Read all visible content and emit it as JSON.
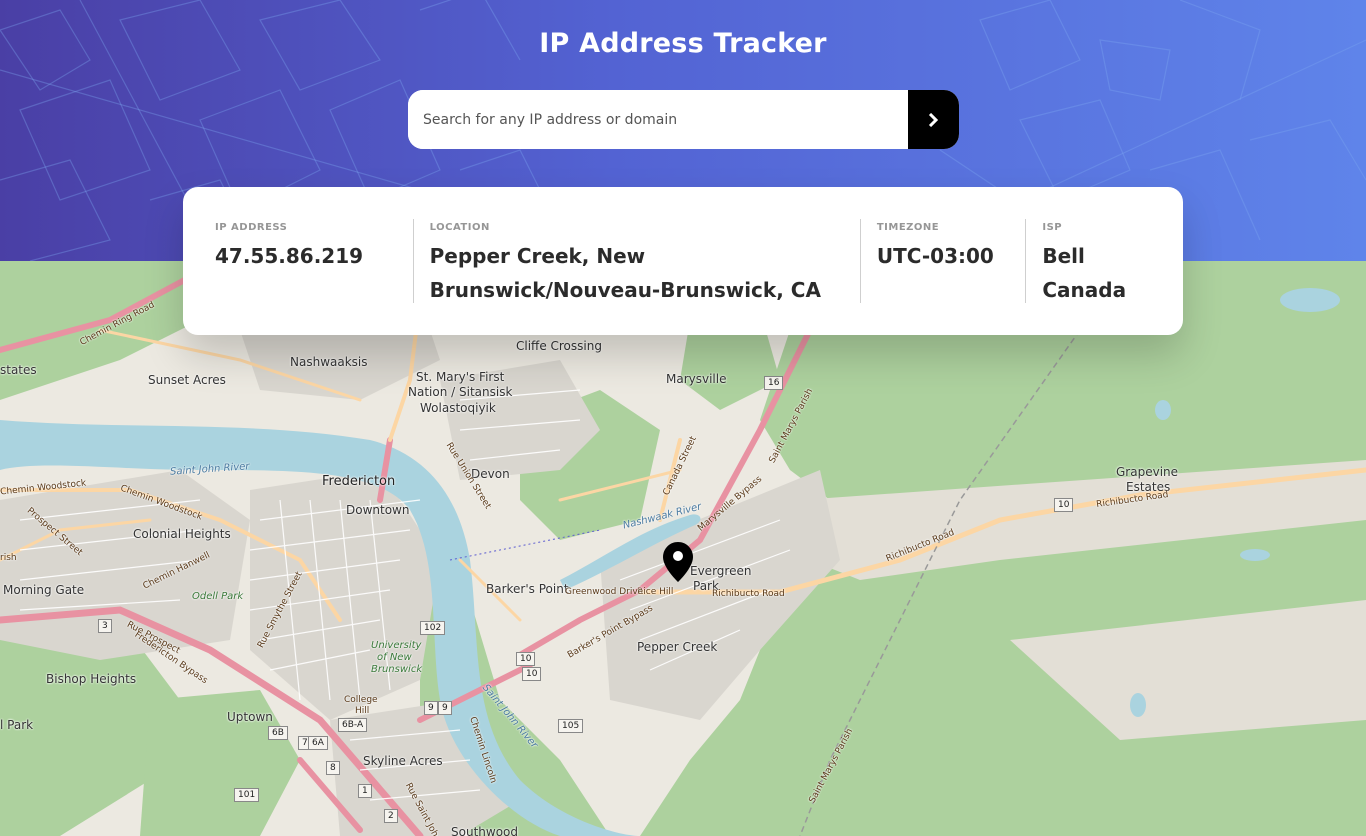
{
  "header": {
    "title": "IP Address Tracker",
    "search_placeholder": "Search for any IP address or domain",
    "search_value": "",
    "submit_icon": "chevron-right-icon"
  },
  "info": {
    "ip_label": "IP ADDRESS",
    "ip_value": "47.55.86.219",
    "location_label": "LOCATION",
    "location_value": "Pepper Creek, New Brunswick/Nouveau-Brunswick, CA",
    "timezone_label": "TIMEZONE",
    "timezone_value": "UTC-03:00",
    "isp_label": "ISP",
    "isp_value": "Bell Canada"
  },
  "map": {
    "marker_icon": "map-pin-icon",
    "places": [
      "Nashwaaksis",
      "Cliffe Crossing",
      "Sunset Acres",
      "St. Mary's First",
      "Nation / Sitansisk",
      "Wolastoqiyik",
      "Marysville",
      "Devon",
      "Fredericton",
      "Downtown",
      "Colonial Heights",
      "Morning Gate",
      "Odell Park",
      "Barker's Point",
      "Evergreen",
      "Park",
      "Rice Hill",
      "Pepper Creek",
      "Bishop Heights",
      "Uptown",
      "University",
      "of New",
      "Brunswick",
      "College",
      "Hill",
      "Skyline Acres",
      "Southwood",
      "Grapevine",
      "Estates",
      "l Park",
      "rish",
      "states"
    ],
    "waters": [
      "Saint John River",
      "Nashwaak River",
      "Saint John River"
    ],
    "roads": [
      "Chemin Ring Road",
      "Chemin Woodstock",
      "Prospect Street",
      "Chemin Hanwell",
      "Rue Smythe Street",
      "Rue Prospect",
      "Fredericton Bypass",
      "Rue Union Street",
      "Canada Street",
      "Marysville Bypass",
      "Greenwood Drive",
      "Richibucto Road",
      "Barker's Point Bypass",
      "Saint Marys Parish",
      "Richibucto Road",
      "Chemin Lincoln",
      "Saint Marys Parish",
      "Richibucto Road",
      "Chemin Woodstock",
      "Rue Saint John Street"
    ],
    "shields": [
      "16",
      "10",
      "102",
      "10",
      "10",
      "105",
      "101",
      "6B-A",
      "6B",
      "7",
      "6A",
      "9",
      "9",
      "1",
      "2",
      "8",
      "3"
    ],
    "colors": {
      "land": "#ece9e1",
      "forest": "#add19e",
      "water": "#aad3df",
      "residential": "#d9d6cf",
      "major_road": "#e892a2",
      "secondary_road": "#fcd6a4"
    }
  }
}
